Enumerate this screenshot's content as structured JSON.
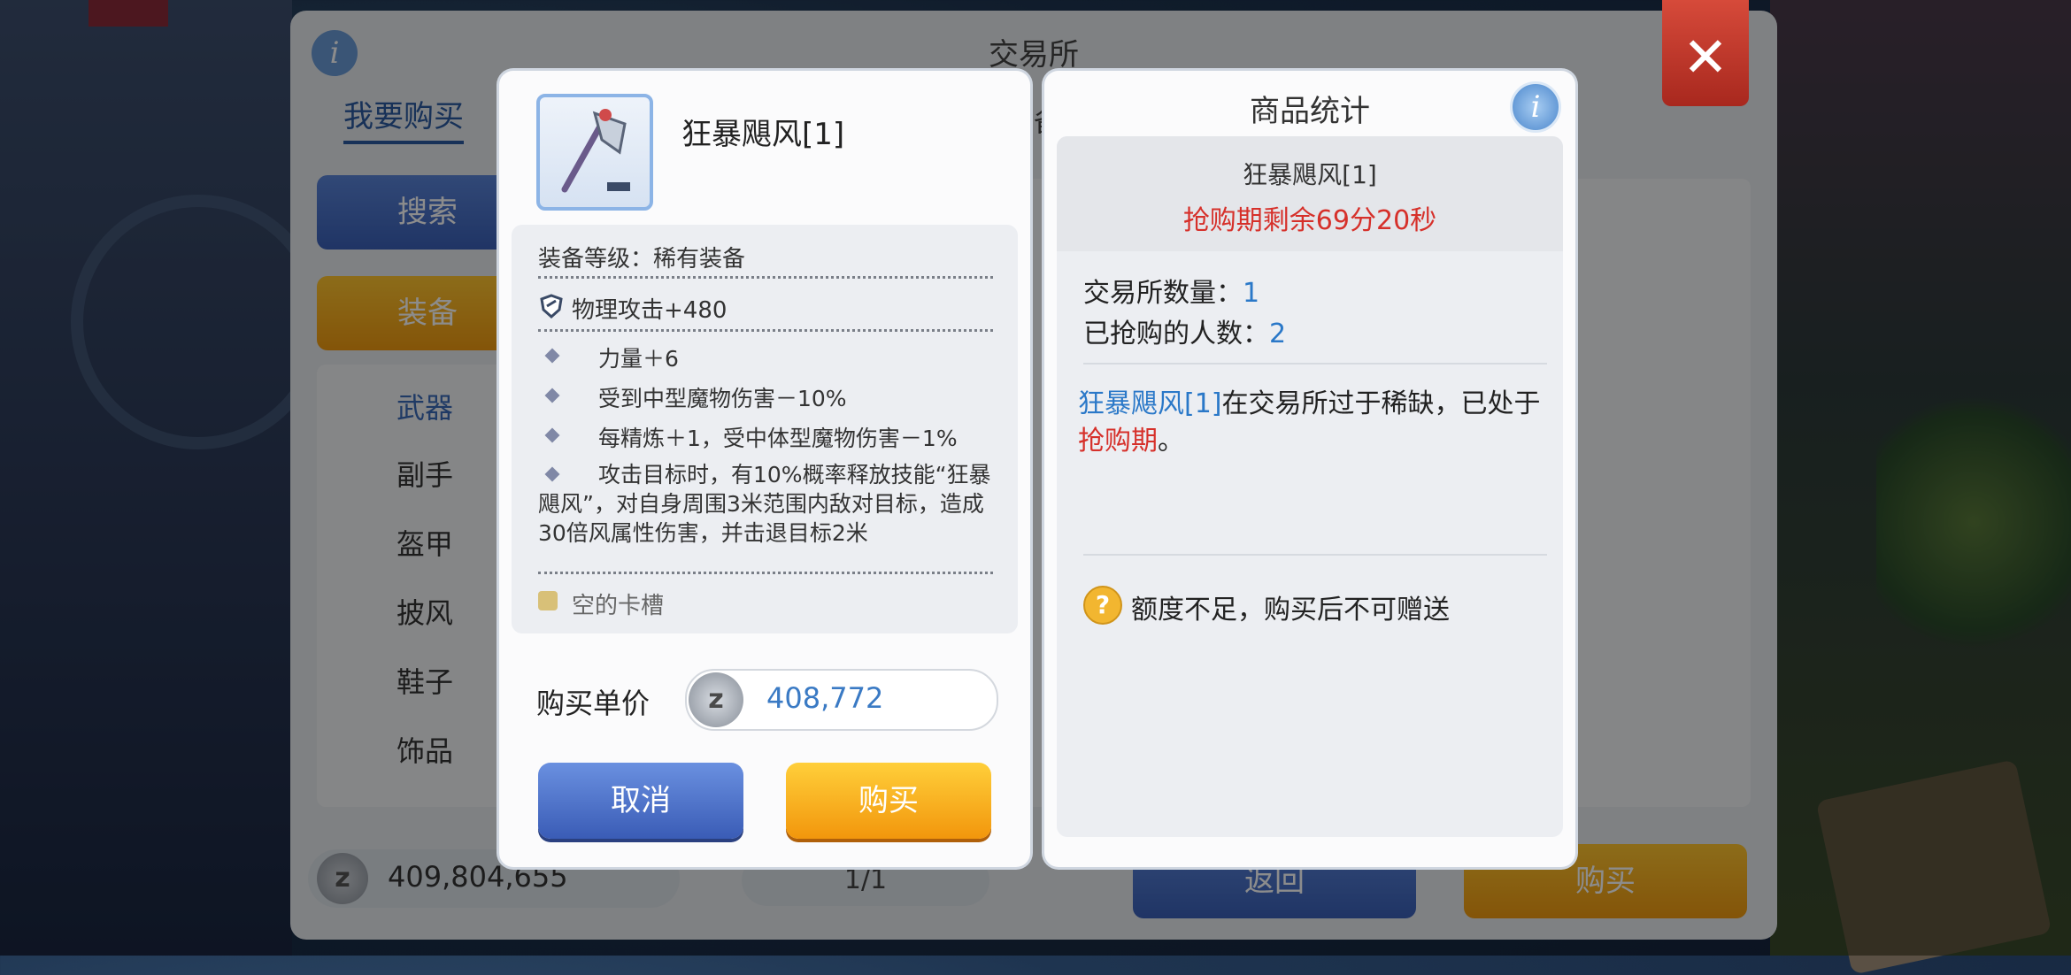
{
  "main": {
    "title": "交易所",
    "info_icon": "i",
    "tab_buy": "我要购买",
    "tab_other": "备",
    "search_button": "搜索",
    "equip_button": "装备",
    "categories": [
      "武器",
      "副手",
      "盔甲",
      "披风",
      "鞋子",
      "饰品"
    ],
    "zeny_icon": "z",
    "zeny_balance": "409,804,655",
    "pager": "1/1",
    "back_button": "返回",
    "buy_button": "购买",
    "close_icon": "✕"
  },
  "item_popup": {
    "item_name": "狂暴飓风[1]",
    "equip_level": "装备等级：稀有装备",
    "base_stat": "物理攻击+480",
    "effects": [
      "力量＋6",
      "受到中型魔物伤害－10%",
      "每精炼＋1，受中体型魔物伤害－1%"
    ],
    "skill_effect": "攻击目标时，有10%概率释放技能“狂暴飓风”，对自身周围3米范围内敌对目标，造成30倍风属性伤害，并击退目标2米",
    "card_slot": "空的卡槽",
    "price_label": "购买单价",
    "price_icon": "z",
    "price_value": "408,772",
    "cancel_button": "取消",
    "buy_button": "购买"
  },
  "stats_popup": {
    "title": "商品统计",
    "info_icon": "i",
    "item_name": "狂暴飓风[1]",
    "timer": "抢购期剩余69分20秒",
    "exchange_qty_label": "交易所数量：",
    "exchange_qty_value": "1",
    "buyers_label": "已抢购的人数：",
    "buyers_value": "2",
    "desc_item": "狂暴飓风[1]",
    "desc_mid": "在交易所过于稀缺，已处于",
    "desc_period": "抢购期",
    "desc_end": "。",
    "warning_icon": "?",
    "warning": "额度不足，购买后不可赠送"
  },
  "colors": {
    "accent_blue": "#2a78c8",
    "warning_red": "#d6302a",
    "button_blue": "#3a5cb6",
    "button_orange": "#f2960c"
  }
}
